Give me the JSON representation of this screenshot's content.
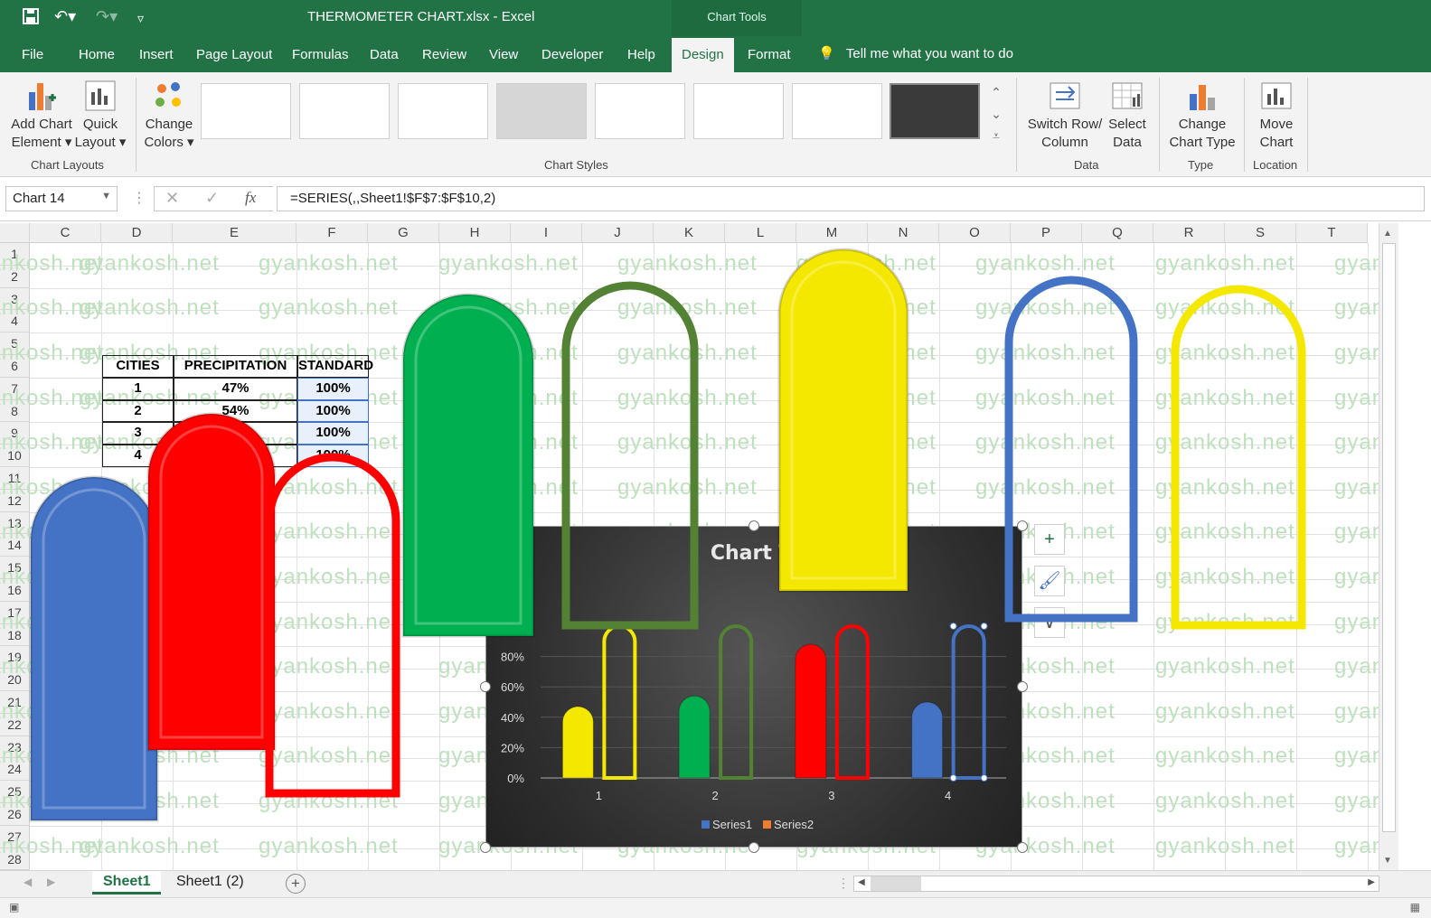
{
  "window": {
    "title": "THERMOMETER CHART.xlsx  -  Excel",
    "context_tab_group": "Chart Tools"
  },
  "tabs": [
    {
      "label": "File"
    },
    {
      "label": "Home"
    },
    {
      "label": "Insert"
    },
    {
      "label": "Page Layout"
    },
    {
      "label": "Formulas"
    },
    {
      "label": "Data"
    },
    {
      "label": "Review"
    },
    {
      "label": "View"
    },
    {
      "label": "Developer"
    },
    {
      "label": "Help"
    },
    {
      "label": "Design",
      "active": true
    },
    {
      "label": "Format"
    }
  ],
  "tell_me": "Tell me what you want to do",
  "ribbon": {
    "add_chart_element": [
      "Add Chart",
      "Element ▾"
    ],
    "quick_layout": [
      "Quick",
      "Layout ▾"
    ],
    "change_colors": [
      "Change",
      "Colors ▾"
    ],
    "group_chart_layouts": "Chart Layouts",
    "group_chart_styles": "Chart Styles",
    "switch_row_column": [
      "Switch Row/",
      "Column"
    ],
    "select_data": [
      "Select",
      "Data"
    ],
    "group_data": "Data",
    "change_chart_type": [
      "Change",
      "Chart Type"
    ],
    "group_type": "Type",
    "move_chart": [
      "Move",
      "Chart"
    ],
    "group_location": "Location"
  },
  "formula_bar": {
    "name_box": "Chart 14",
    "formula": "=SERIES(,,Sheet1!$F$7:$F$10,2)"
  },
  "columns": [
    "C",
    "D",
    "E",
    "F",
    "G",
    "H",
    "I",
    "J",
    "K",
    "L",
    "M",
    "N",
    "O",
    "P",
    "Q",
    "R",
    "S",
    "T"
  ],
  "rows": [
    "1",
    "2",
    "3",
    "4",
    "5",
    "6",
    "7",
    "8",
    "9",
    "10",
    "11",
    "12",
    "13",
    "14",
    "15",
    "16",
    "17",
    "18",
    "19",
    "20",
    "21",
    "22",
    "23",
    "24",
    "25",
    "26",
    "27",
    "28",
    "29"
  ],
  "watermark": "gyankosh.net",
  "table": {
    "headers": [
      "CITIES",
      "PRECIPITATION",
      "STANDARD"
    ],
    "rows": [
      [
        "1",
        "47%",
        "100%"
      ],
      [
        "2",
        "54%",
        "100%"
      ],
      [
        "3",
        "",
        "100%"
      ],
      [
        "4",
        "",
        "100%"
      ]
    ]
  },
  "chart_data": {
    "type": "bar",
    "title": "Chart Ti",
    "categories": [
      "1",
      "2",
      "3",
      "4"
    ],
    "y_ticks": [
      "0%",
      "20%",
      "40%",
      "60%",
      "80%"
    ],
    "ylim": [
      0,
      1
    ],
    "series": [
      {
        "name": "Series1",
        "values": [
          0.47,
          0.54,
          0.88,
          0.5
        ],
        "fill_colors": [
          "#f5e800",
          "#00b050",
          "#ff0000",
          "#4472c4"
        ]
      },
      {
        "name": "Series2",
        "values": [
          1.0,
          1.0,
          1.0,
          1.0
        ],
        "outline_colors": [
          "#f5e800",
          "#548235",
          "#ff0000",
          "#4472c4"
        ]
      }
    ],
    "legend_position": "bottom",
    "legend_colors": [
      "#4472c4",
      "#ed7d31"
    ]
  },
  "sheets": [
    {
      "label": "Sheet1",
      "active": true
    },
    {
      "label": "Sheet1 (2)",
      "active": false
    }
  ],
  "colors": {
    "excel_green": "#217346",
    "blue": "#4472c4",
    "red": "#ff0000",
    "green": "#00b050",
    "yellow": "#f5e800",
    "dark_green": "#548235"
  }
}
